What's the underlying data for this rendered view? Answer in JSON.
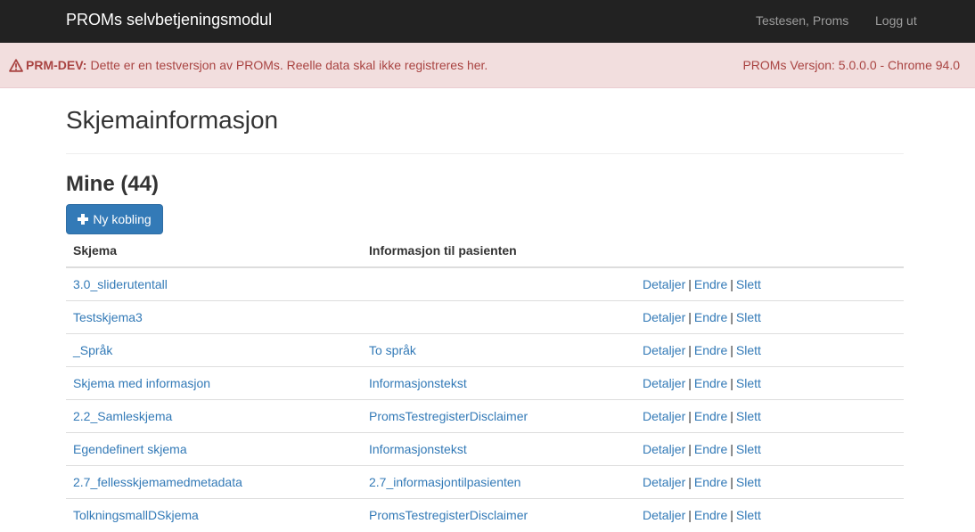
{
  "navbar": {
    "brand": "PROMs selvbetjeningsmodul",
    "user": "Testesen, Proms",
    "logout": "Logg ut"
  },
  "alert": {
    "label": "PRM-DEV:",
    "message": "Dette er en testversjon av PROMs. Reelle data skal ikke registreres her.",
    "version": "PROMs Versjon: 5.0.0.0 - Chrome 94.0",
    "icon": "warning-triangle-icon"
  },
  "page": {
    "title": "Skjemainformasjon",
    "section_title": "Mine (44)",
    "new_button": "Ny kobling"
  },
  "table": {
    "headers": [
      "Skjema",
      "Informasjon til pasienten",
      ""
    ],
    "actions": {
      "details": "Detaljer",
      "edit": "Endre",
      "delete": "Slett",
      "separator": "|"
    },
    "rows": [
      {
        "skjema": "3.0_sliderutentall",
        "info": ""
      },
      {
        "skjema": "Testskjema3",
        "info": ""
      },
      {
        "skjema": "_Språk",
        "info": "To språk"
      },
      {
        "skjema": "Skjema med informasjon",
        "info": "Informasjonstekst"
      },
      {
        "skjema": "2.2_Samleskjema",
        "info": "PromsTestregisterDisclaimer"
      },
      {
        "skjema": "Egendefinert skjema",
        "info": "Informasjonstekst"
      },
      {
        "skjema": "2.7_fellesskjemamedmetadata",
        "info": "2.7_informasjontilpasienten"
      },
      {
        "skjema": "TolkningsmallDSkjema",
        "info": "PromsTestregisterDisclaimer"
      }
    ]
  },
  "colors": {
    "navbar_bg": "#222222",
    "alert_bg": "#f2dede",
    "alert_text": "#a94442",
    "link": "#337ab7",
    "primary_button": "#337ab7"
  }
}
